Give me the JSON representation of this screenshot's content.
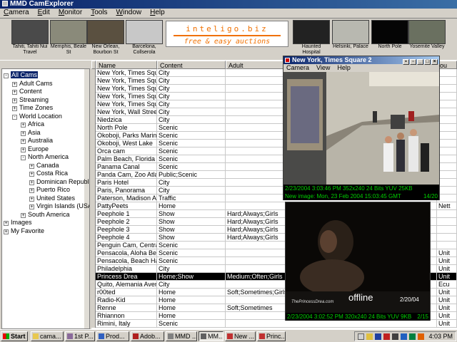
{
  "window": {
    "title": "MMD CamExplorer"
  },
  "menu": [
    "Camera",
    "Edit",
    "Monitor",
    "Tools",
    "Window",
    "Help"
  ],
  "thumbnails": [
    {
      "caption": "Tahiti, Tahiti Nui Travel",
      "color": "#4a4a4a"
    },
    {
      "caption": "Memphis, Beale St",
      "color": "#8a8a7a"
    },
    {
      "caption": "New Orlean, Bourbon St",
      "color": "#5a5040"
    },
    {
      "caption": "Barcelona, Collserola",
      "color": "#c8c8c8"
    },
    {
      "caption": "Haunted Hospital",
      "color": "#222222"
    },
    {
      "caption": "Helsinki, Palace",
      "color": "#b8b8b0"
    },
    {
      "caption": "North Pole",
      "color": "#050505"
    },
    {
      "caption": "Yosemite Valley",
      "color": "#6a7060"
    }
  ],
  "ad": {
    "line1": "inteligo.biz",
    "line2": "free & easy auctions",
    "color": "#f07000"
  },
  "tree": [
    {
      "label": "All Cams",
      "level": 0,
      "exp": "-",
      "selected": true
    },
    {
      "label": "Adult Cams",
      "level": 1,
      "exp": "+"
    },
    {
      "label": "Content",
      "level": 1,
      "exp": "+"
    },
    {
      "label": "Streaming",
      "level": 1,
      "exp": "+"
    },
    {
      "label": "Time Zones",
      "level": 1,
      "exp": "+"
    },
    {
      "label": "World Location",
      "level": 1,
      "exp": "-"
    },
    {
      "label": "Africa",
      "level": 2,
      "exp": "+"
    },
    {
      "label": "Asia",
      "level": 2,
      "exp": "+"
    },
    {
      "label": "Australia",
      "level": 2,
      "exp": "+"
    },
    {
      "label": "Europe",
      "level": 2,
      "exp": "+"
    },
    {
      "label": "North America",
      "level": 2,
      "exp": "-"
    },
    {
      "label": "Canada",
      "level": 3,
      "exp": "+"
    },
    {
      "label": "Costa Rica",
      "level": 3,
      "exp": "+"
    },
    {
      "label": "Dominican Republic",
      "level": 3,
      "exp": "+"
    },
    {
      "label": "Puerto Rico",
      "level": 3,
      "exp": "+"
    },
    {
      "label": "United States",
      "level": 3,
      "exp": "+"
    },
    {
      "label": "Virgin Islands (USA)",
      "level": 3,
      "exp": "+"
    },
    {
      "label": "South America",
      "level": 2,
      "exp": "+"
    },
    {
      "label": "Images",
      "level": 0,
      "exp": "+"
    },
    {
      "label": "My Favorite",
      "level": 0,
      "exp": "+"
    }
  ],
  "grid": {
    "columns": [
      "Name",
      "Content",
      "Adult",
      "ou"
    ],
    "rows": [
      [
        "New York, Times Square",
        "City",
        "",
        ""
      ],
      [
        "New York, Times Square",
        "City",
        "",
        ""
      ],
      [
        "New York, Times Square",
        "City",
        "",
        ""
      ],
      [
        "New York, Times Square",
        "City",
        "",
        ""
      ],
      [
        "New York, Times Square",
        "City",
        "",
        ""
      ],
      [
        "New York, Wall Street",
        "City",
        "",
        ""
      ],
      [
        "Niedzica",
        "City",
        "",
        ""
      ],
      [
        "North Pole",
        "Scenic",
        "",
        ""
      ],
      [
        "Okoboji, Parks Marina",
        "Scenic",
        "",
        ""
      ],
      [
        "Okoboji, West Lake",
        "Scenic",
        "",
        ""
      ],
      [
        "Orca cam",
        "Scenic",
        "",
        ""
      ],
      [
        "Palm Beach, Florida",
        "Scenic",
        "",
        ""
      ],
      [
        "Panama Canal",
        "Scenic",
        "",
        ""
      ],
      [
        "Panda Cam, Zoo Atlanta",
        "Public;Scenic",
        "",
        ""
      ],
      [
        "Paris Hotel",
        "City",
        "",
        ""
      ],
      [
        "Paris, Panorama",
        "City",
        "",
        ""
      ],
      [
        "Paterson, Madison Ave",
        "Traffic",
        "",
        ""
      ],
      [
        "PattyPeets",
        "Home",
        "",
        "Nett"
      ],
      [
        "Peephole 1",
        "Show",
        "Hard;Always;Girls",
        ""
      ],
      [
        "Peephole 2",
        "Show",
        "Hard;Always;Girls",
        ""
      ],
      [
        "Peephole 3",
        "Show",
        "Hard;Always;Girls",
        ""
      ],
      [
        "Peephole 4",
        "Show",
        "Hard;Always;Girls",
        ""
      ],
      [
        "Penguin Cam, Central Park",
        "Scenic",
        "",
        ""
      ],
      [
        "Pensacola, Aloha Beach",
        "Scenic",
        "",
        "Unit"
      ],
      [
        "Pensacola, Beach Harbor",
        "Scenic",
        "",
        "Unit"
      ],
      [
        "Philadelphia",
        "City",
        "",
        "Unit"
      ],
      [
        "Princess Drea",
        "Home;Show",
        "Medium;Often;Girls",
        "Unit"
      ],
      [
        "Quito, Alemania Avenue",
        "City",
        "",
        "Ecu"
      ],
      [
        "r00ted",
        "Home",
        "Soft;Sometimes;Girls",
        "Unit"
      ],
      [
        "Radio-Kid",
        "Home",
        "",
        "Unit"
      ],
      [
        "Renne",
        "Home",
        "Soft;Sometimes",
        "Unit"
      ],
      [
        "Rhiannon",
        "Home",
        "",
        "Unit"
      ],
      [
        "Rimini, Italy",
        "Scenic",
        "",
        "Unit"
      ]
    ],
    "selected_row": 26
  },
  "cam_window_1": {
    "title": "New York, Times Square 2",
    "menu": [
      "Camera",
      "View",
      "Help"
    ],
    "status1": "2/23/2004 3:03:46 PM 352x240 24 Bits YUV 25KB",
    "status2": "New image: Mon, 23 Feb 2004 15:03:45 GMT",
    "status2_right": "14/20"
  },
  "cam_window_2": {
    "overlay_text": "offline",
    "watermark": "ThePrincessDrea.com",
    "date_stamp": "2/20/04",
    "status1": "2/23/2004 3:02:52 PM 320x240 24 Bits YUV 9KB",
    "status1_right": "2/15"
  },
  "taskbar": {
    "start": "Start",
    "tasks": [
      {
        "label": "cama...",
        "color": "#e8c850"
      },
      {
        "label": "1st P...",
        "color": "#8a6a9a"
      },
      {
        "label": "Prod...",
        "color": "#3060c0"
      },
      {
        "label": "Adob...",
        "color": "#b02020"
      },
      {
        "label": "MMD ...",
        "color": "#808080"
      },
      {
        "label": "MM...",
        "color": "#606060",
        "active": true
      },
      {
        "label": "New ...",
        "color": "#c03030"
      },
      {
        "label": "Princ...",
        "color": "#c03030"
      }
    ],
    "clock": "4:03 PM"
  }
}
